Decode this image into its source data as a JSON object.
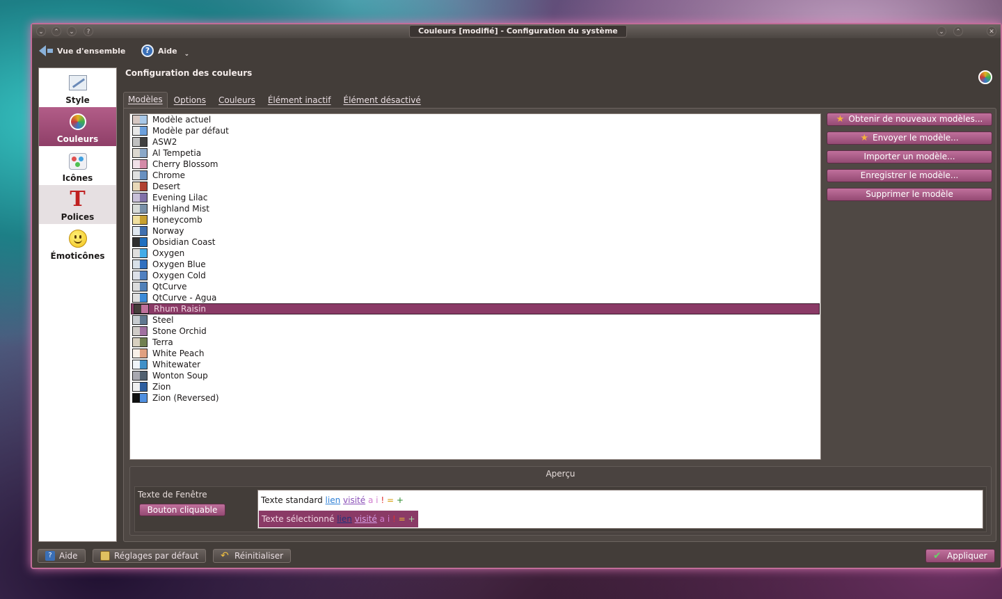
{
  "window": {
    "title": "Couleurs [modifié] - Configuration du système",
    "title_buttons": [
      "⌄",
      "⌃",
      "⌄",
      "?"
    ],
    "right_buttons": [
      "⌄",
      "⌃",
      "✕"
    ]
  },
  "toolbar": {
    "overview_label": "Vue d'ensemble",
    "help_label": "Aide",
    "help_chevron": "⌄"
  },
  "sidebar": {
    "items": [
      {
        "label": "Style",
        "icon": "style-icon"
      },
      {
        "label": "Couleurs",
        "icon": "colors-icon",
        "active": true
      },
      {
        "label": "Icônes",
        "icon": "icons-icon"
      },
      {
        "label": "Polices",
        "icon": "fonts-icon"
      },
      {
        "label": "Émoticônes",
        "icon": "emoticons-icon"
      }
    ]
  },
  "page": {
    "title": "Configuration des couleurs"
  },
  "tabs": [
    {
      "label": "Modèles",
      "active": true
    },
    {
      "label": "Options"
    },
    {
      "label": "Couleurs"
    },
    {
      "label": "Élément inactif"
    },
    {
      "label": "Élément désactivé"
    }
  ],
  "schemes": [
    {
      "name": "Modèle actuel",
      "colors": [
        "#d6c7c2",
        "#a8c8e8"
      ]
    },
    {
      "name": "Modèle par défaut",
      "colors": [
        "#e8e8e8",
        "#6ca0dc"
      ]
    },
    {
      "name": "ASW2",
      "colors": [
        "#c0c0c0",
        "#404040"
      ]
    },
    {
      "name": "Al Tempetia",
      "colors": [
        "#dcd8d0",
        "#8aa8c8"
      ]
    },
    {
      "name": "Cherry Blossom",
      "colors": [
        "#f0e0e8",
        "#d48aa8"
      ]
    },
    {
      "name": "Chrome",
      "colors": [
        "#e0e0e0",
        "#6890c0"
      ]
    },
    {
      "name": "Desert",
      "colors": [
        "#e8d8b8",
        "#b04030"
      ]
    },
    {
      "name": "Evening Lilac",
      "colors": [
        "#c8c0d8",
        "#8070a8"
      ]
    },
    {
      "name": "Highland Mist",
      "colors": [
        "#d8dcd8",
        "#7890a8"
      ]
    },
    {
      "name": "Honeycomb",
      "colors": [
        "#f0e0a0",
        "#c8a030"
      ]
    },
    {
      "name": "Norway",
      "colors": [
        "#e0e8f0",
        "#4070b0"
      ]
    },
    {
      "name": "Obsidian Coast",
      "colors": [
        "#303030",
        "#2070c0"
      ]
    },
    {
      "name": "Oxygen",
      "colors": [
        "#e0dfde",
        "#43ace8"
      ]
    },
    {
      "name": "Oxygen Blue",
      "colors": [
        "#d8e0e8",
        "#3070c0"
      ]
    },
    {
      "name": "Oxygen Cold",
      "colors": [
        "#dce0e8",
        "#5080c0"
      ]
    },
    {
      "name": "QtCurve",
      "colors": [
        "#dcdcdc",
        "#5080b8"
      ]
    },
    {
      "name": "QtCurve - Agua",
      "colors": [
        "#e0e0e0",
        "#3a8ad8"
      ]
    },
    {
      "name": "Rhum Raisin",
      "colors": [
        "#433d39",
        "#c0709c"
      ],
      "selected": true
    },
    {
      "name": "Steel",
      "colors": [
        "#c8ccd0",
        "#607890"
      ]
    },
    {
      "name": "Stone Orchid",
      "colors": [
        "#d0ccc8",
        "#a070a0"
      ]
    },
    {
      "name": "Terra",
      "colors": [
        "#d8d0c0",
        "#708050"
      ]
    },
    {
      "name": "White Peach",
      "colors": [
        "#f8f0e8",
        "#e0a080"
      ]
    },
    {
      "name": "Whitewater",
      "colors": [
        "#f0f4f8",
        "#4090c8"
      ]
    },
    {
      "name": "Wonton Soup",
      "colors": [
        "#a8a8b0",
        "#506070"
      ]
    },
    {
      "name": "Zion",
      "colors": [
        "#f0f0f0",
        "#3060a0"
      ]
    },
    {
      "name": "Zion (Reversed)",
      "colors": [
        "#101010",
        "#5090e0"
      ]
    }
  ],
  "actions": [
    {
      "label": "Obtenir de nouveaux modèles...",
      "icon": "star-icon"
    },
    {
      "label": "Envoyer le modèle...",
      "icon": "star-icon"
    },
    {
      "label": "Importer un modèle..."
    },
    {
      "label": "Enregistrer le modèle..."
    },
    {
      "label": "Supprimer le modèle"
    }
  ],
  "preview": {
    "title": "Aperçu",
    "window_text": "Texte de Fenêtre",
    "button_label": "Bouton cliquable",
    "standard_text": "Texte standard",
    "selected_text": "Texte sélectionné",
    "link": "lien",
    "visited": "visité",
    "neutral": "a",
    "active": "i",
    "negative": "!",
    "warning": "=",
    "positive": "+"
  },
  "footer": {
    "help": "Aide",
    "defaults": "Réglages par défaut",
    "reset": "Réinitialiser",
    "apply": "Appliquer"
  },
  "colors": {
    "accent": "#c0709c",
    "window_bg": "#433d39",
    "selection": "#8a3a66"
  }
}
